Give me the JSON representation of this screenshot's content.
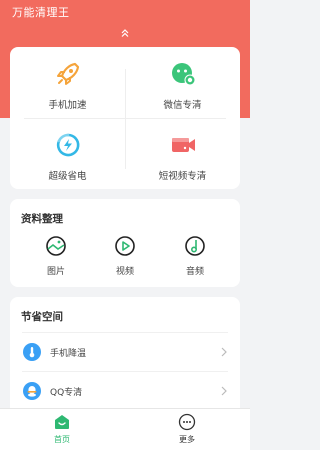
{
  "app": {
    "title": "万能清理王"
  },
  "tools": [
    {
      "label": "手机加速",
      "icon": "rocket-icon",
      "color": "#f5a43b"
    },
    {
      "label": "微信专清",
      "icon": "wechat-icon",
      "color": "#3bc57a"
    },
    {
      "label": "超级省电",
      "icon": "battery-saver-icon",
      "color": "#33b8e6"
    },
    {
      "label": "短视频专清",
      "icon": "video-camera-icon",
      "color": "#f06565"
    }
  ],
  "files_section": {
    "title": "资料整理",
    "items": [
      {
        "label": "图片",
        "icon": "image-icon"
      },
      {
        "label": "视频",
        "icon": "video-icon"
      },
      {
        "label": "音频",
        "icon": "audio-icon"
      }
    ]
  },
  "space_section": {
    "title": "节省空间",
    "items": [
      {
        "label": "手机降温",
        "icon": "thermometer-icon"
      },
      {
        "label": "QQ专清",
        "icon": "qq-icon"
      }
    ]
  },
  "bottom_nav": [
    {
      "label": "首页",
      "icon": "home-icon",
      "active": true
    },
    {
      "label": "更多",
      "icon": "more-icon",
      "active": false
    }
  ],
  "colors": {
    "header": "#f26b5e",
    "accent_green": "#2eb872",
    "icon_dark": "#222222",
    "icon_blue": "#3aa0f5"
  }
}
